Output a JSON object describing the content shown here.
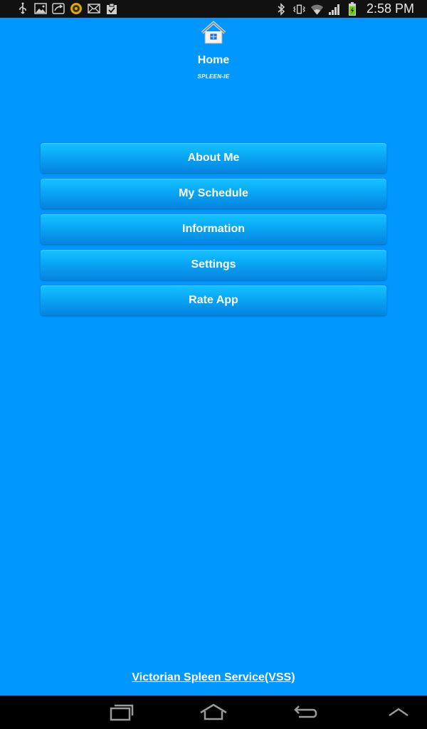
{
  "status_bar": {
    "time": "2:58 PM",
    "left_icons": [
      "usb-icon",
      "image-icon",
      "share-icon",
      "app-icon",
      "mail-icon",
      "clipboard-check-icon"
    ],
    "right_icons": [
      "bluetooth-icon",
      "vibrate-icon",
      "wifi-icon",
      "signal-icon",
      "battery-charging-icon"
    ]
  },
  "header": {
    "icon": "home-icon",
    "title": "Home",
    "subtitle": "SPLEEN-IE"
  },
  "menu": {
    "items": [
      {
        "label": "About Me"
      },
      {
        "label": "My Schedule"
      },
      {
        "label": "Information"
      },
      {
        "label": "Settings"
      },
      {
        "label": "Rate App"
      }
    ]
  },
  "footer": {
    "link": "Victorian Spleen Service(VSS)"
  },
  "nav_bar": {
    "buttons": [
      "recent-apps-icon",
      "home-icon",
      "back-icon",
      "menu-up-icon"
    ]
  },
  "colors": {
    "background": "#0097ff",
    "button_top": "#16c3ff",
    "button_bottom": "#0584e0",
    "status_bar": "#111111",
    "nav_bar": "#000000"
  }
}
